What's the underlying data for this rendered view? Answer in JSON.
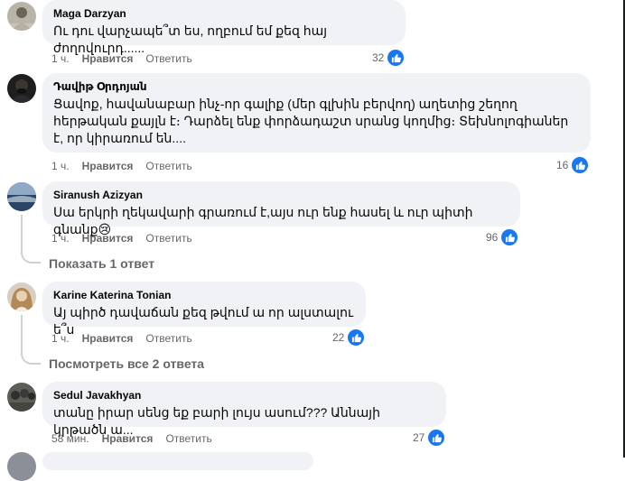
{
  "comments": [
    {
      "author": "Maga Darzyan",
      "text": "Ու դու վարչապե՞տ ես, ողբում եմ քեզ հայ ժողովուրդ......",
      "time": "1 ч.",
      "like_label": "Нравится",
      "reply_label": "Ответить",
      "reactions": "32"
    },
    {
      "author": "Դավիթ Օրդոյան",
      "text": "Ցավոք, հավանաբար ինչ-որ գալիք (մեր գլխին բերվող) աղետից շեղող հերթական քայլն է։ Դարձել ենք փորձադաշտ սրանց կողմից։ Տեխնոլոգիաներ է, որ կիրառում են....",
      "time": "1 ч.",
      "like_label": "Нравится",
      "reply_label": "Ответить",
      "reactions": "16"
    },
    {
      "author": "Siranush Azizyan",
      "text": "Սա երկրի ղեկավարի գրառում է,այս ուր ենք հասել և ուր պիտի գնանք",
      "emoji": "😢",
      "time": "1 ч.",
      "like_label": "Нравится",
      "reply_label": "Ответить",
      "reactions": "96",
      "replies_link": "Показать 1 ответ"
    },
    {
      "author": "Karine Katerina Tonian",
      "text": "Այ պիրծ դավաճան քեզ թվում ա որ ալստալու ե՞ս",
      "time": "1 ч.",
      "like_label": "Нравится",
      "reply_label": "Ответить",
      "reactions": "22",
      "replies_link": "Посмотреть все 2 ответа"
    },
    {
      "author": "Sedul Javakhyan",
      "text": "տանը իրար սենց եք բարի լույս ասում??? Աննայի կրթածն ա...",
      "time": "58 мин.",
      "like_label": "Нравится",
      "reply_label": "Ответить",
      "reactions": "27"
    }
  ],
  "colors": {
    "bubble": "#f0f2f5",
    "meta": "#65676b",
    "like_blue": "#1877f2",
    "thread": "#ced0d4"
  }
}
